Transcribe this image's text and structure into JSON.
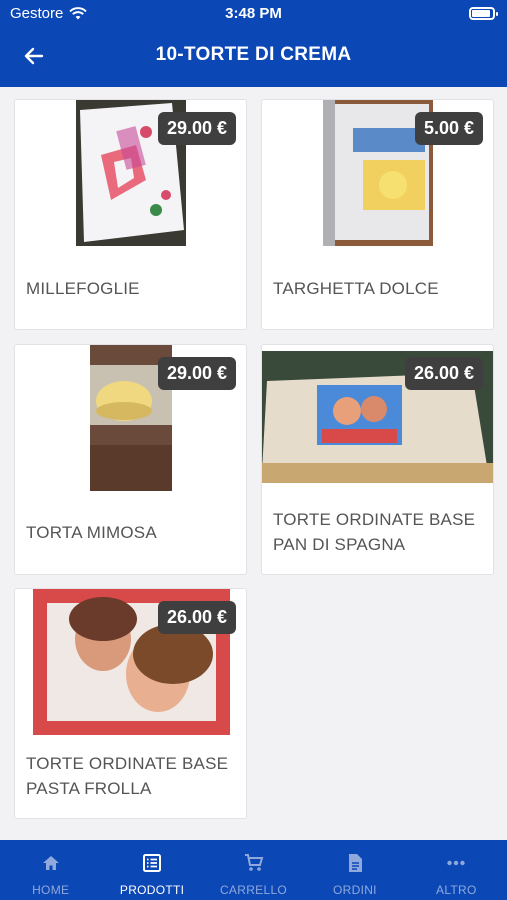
{
  "status_bar": {
    "carrier": "Gestore",
    "time": "3:48 PM"
  },
  "header": {
    "title": "10-TORTE DI CREMA"
  },
  "products": [
    {
      "name": "MILLEFOGLIE",
      "price": "29.00 €"
    },
    {
      "name": "TARGHETTA DOLCE",
      "price": "5.00 €"
    },
    {
      "name": "TORTA MIMOSA",
      "price": "29.00 €"
    },
    {
      "name": "TORTE ORDINATE BASE PAN DI SPAGNA",
      "price": "26.00 €"
    },
    {
      "name": "TORTE ORDINATE BASE PASTA FROLLA",
      "price": "26.00 €"
    }
  ],
  "tabs": [
    {
      "label": "HOME",
      "icon": "home-icon"
    },
    {
      "label": "PRODOTTI",
      "icon": "list-icon",
      "active": true
    },
    {
      "label": "CARRELLO",
      "icon": "cart-icon"
    },
    {
      "label": "ORDINI",
      "icon": "document-icon"
    },
    {
      "label": "ALTRO",
      "icon": "more-icon"
    }
  ],
  "colors": {
    "brand": "#0b47b5",
    "price_badge": "#3f3f3f",
    "background": "#f2f2f4"
  }
}
